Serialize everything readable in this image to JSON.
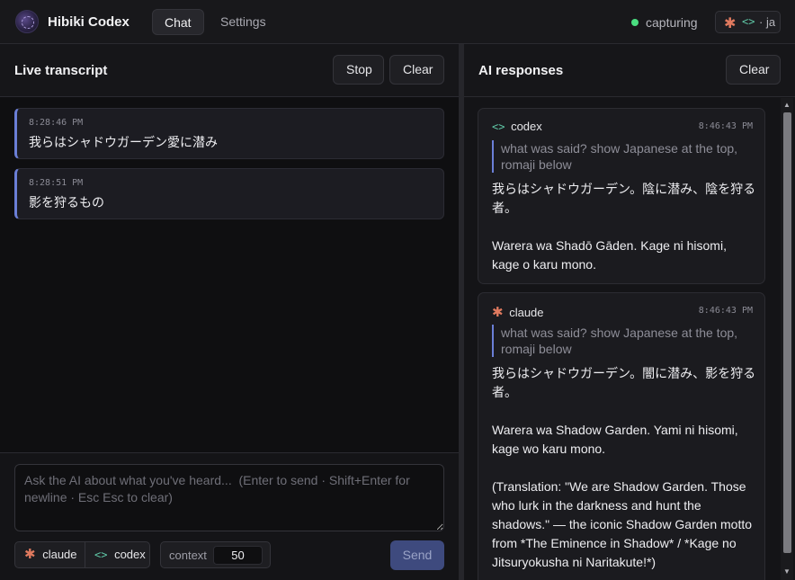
{
  "app": {
    "name": "Hibiki Codex"
  },
  "nav": {
    "tabs": [
      {
        "label": "Chat"
      },
      {
        "label": "Settings"
      }
    ]
  },
  "status": {
    "text": "capturing",
    "color": "#4ade80"
  },
  "provider_pill": {
    "suffix": "· ja"
  },
  "transcript": {
    "title": "Live transcript",
    "stop_label": "Stop",
    "clear_label": "Clear",
    "entries": [
      {
        "time": "8:28:46 PM",
        "text": "我らはシャドウガーデン愛に潜み"
      },
      {
        "time": "8:28:51 PM",
        "text": "影を狩るもの"
      }
    ]
  },
  "composer": {
    "placeholder": "Ask the AI about what you've heard...  (Enter to send · Shift+Enter for newline · Esc Esc to clear)",
    "providers": [
      {
        "label": "claude"
      },
      {
        "label": "codex"
      }
    ],
    "context_label": "context",
    "context_value": "50",
    "send_label": "Send"
  },
  "responses": {
    "title": "AI responses",
    "clear_label": "Clear",
    "cards": [
      {
        "provider": "codex",
        "time": "8:46:43 PM",
        "question": "what was said? show Japanese at the top, romaji below",
        "body": "我らはシャドウガーデン。陰に潜み、陰を狩る者。\n\nWarera wa Shadō Gāden. Kage ni hisomi, kage o karu mono."
      },
      {
        "provider": "claude",
        "time": "8:46:43 PM",
        "question": "what was said? show Japanese at the top, romaji below",
        "body": "我らはシャドウガーデン。闇に潜み、影を狩る者。\n\nWarera wa Shadow Garden. Yami ni hisomi, kage wo karu mono.\n\n(Translation: \"We are Shadow Garden. Those who lurk in the darkness and hunt the shadows.\" — the iconic Shadow Garden motto from *The Eminence in Shadow* / *Kage no Jitsuryokusha ni Naritakute!*)"
      }
    ]
  },
  "colors": {
    "accent": "#6b7fd7",
    "claude": "#e07a5f",
    "codex": "#5fc7a6",
    "background": "#131316"
  },
  "icons": {
    "logo": "app-logo-icon",
    "claude": "asterisk-icon",
    "codex": "code-brackets-icon"
  }
}
